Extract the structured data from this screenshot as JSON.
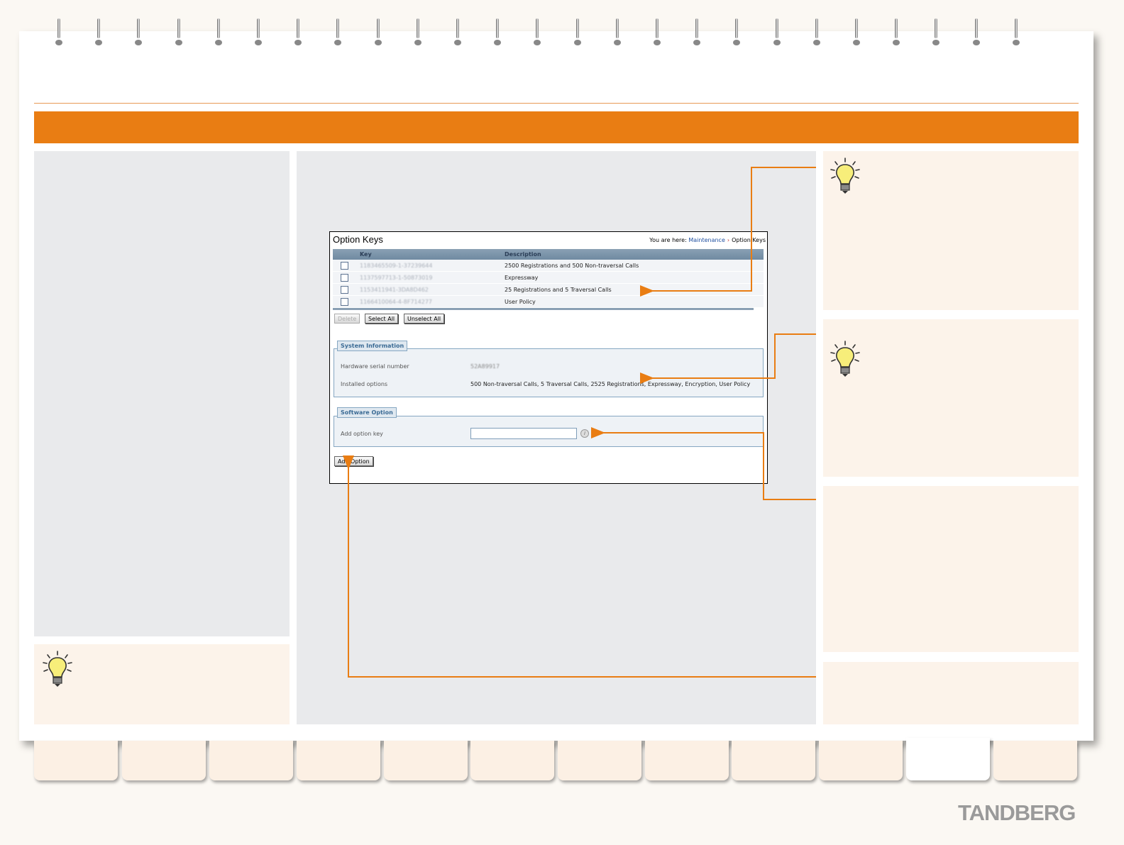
{
  "brand": {
    "logo_text": "TANDBERG",
    "accent": "#e97d13"
  },
  "screenshot": {
    "title": "Option Keys",
    "breadcrumb": {
      "prefix": "You are here:",
      "link": "Maintenance",
      "separator": "›",
      "current": "Option Keys"
    },
    "table": {
      "headers": {
        "key": "Key",
        "description": "Description"
      },
      "rows": [
        {
          "key": "1183465509-1-37239644",
          "description": "2500 Registrations and 500 Non-traversal Calls"
        },
        {
          "key": "1137597713-1-50873019",
          "description": "Expressway"
        },
        {
          "key": "1153411941-3DA8D462",
          "description": "25 Registrations and 5 Traversal Calls"
        },
        {
          "key": "1166410064-4-8F714277",
          "description": "User Policy"
        }
      ]
    },
    "buttons": {
      "delete": "Delete",
      "select_all": "Select All",
      "unselect_all": "Unselect All",
      "add_option": "Add Option"
    },
    "system_information": {
      "legend": "System Information",
      "serial_label": "Hardware serial number",
      "serial_value": "52A89917",
      "options_label": "Installed options",
      "options_value": "500 Non-traversal Calls, 5 Traversal Calls, 2525 Registrations, Expressway, Encryption, User Policy"
    },
    "software_option": {
      "legend": "Software Option",
      "add_label": "Add option key",
      "add_value": "",
      "info_icon": "i"
    }
  },
  "icons": [
    "lightbulb-icon",
    "info-icon",
    "checkbox-icon"
  ]
}
